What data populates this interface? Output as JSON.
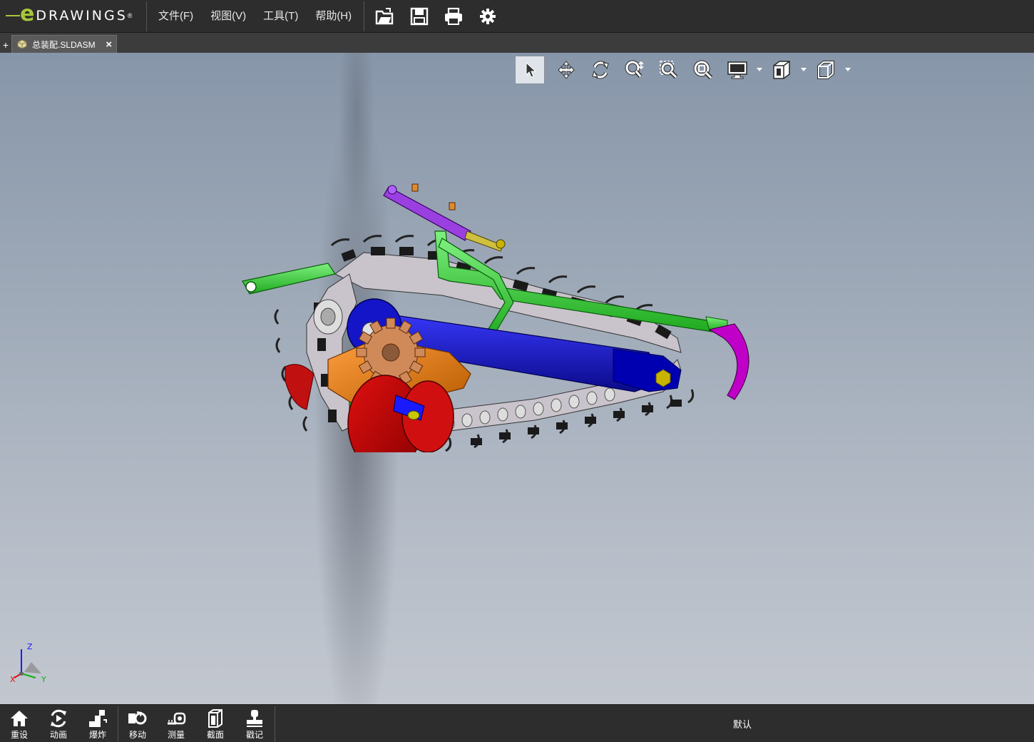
{
  "app": {
    "logo_e": "e",
    "logo_text": "DRAWINGS",
    "logo_reg": "®"
  },
  "menu": {
    "file": "文件(F)",
    "view": "视图(V)",
    "tools": "工具(T)",
    "help": "帮助(H)"
  },
  "toolbar_icons": [
    "open-icon",
    "save-icon",
    "print-icon",
    "settings-icon"
  ],
  "tabs": {
    "add": "+",
    "document": "总装配.SLDASM",
    "close": "×"
  },
  "view_toolbar": [
    "select-icon",
    "pan-icon",
    "rotate-icon",
    "zoom-icon",
    "zoom-to-area-icon",
    "zoom-to-fit-icon",
    "display-style-icon",
    "section-view-icon",
    "standard-views-icon"
  ],
  "triad": {
    "z": "Z",
    "x": "X",
    "y": "Y"
  },
  "bottom": {
    "reset": "重设",
    "animate": "动画",
    "explode": "爆炸",
    "move": "移动",
    "measure": "测量",
    "section": "截面",
    "stamp": "戳记",
    "configuration": "默认"
  },
  "colors": {
    "accent": "#a6c63a",
    "bar": "#2d2d2d",
    "viewport_top": "#8796a9",
    "viewport_bottom": "#c2c7cf"
  }
}
